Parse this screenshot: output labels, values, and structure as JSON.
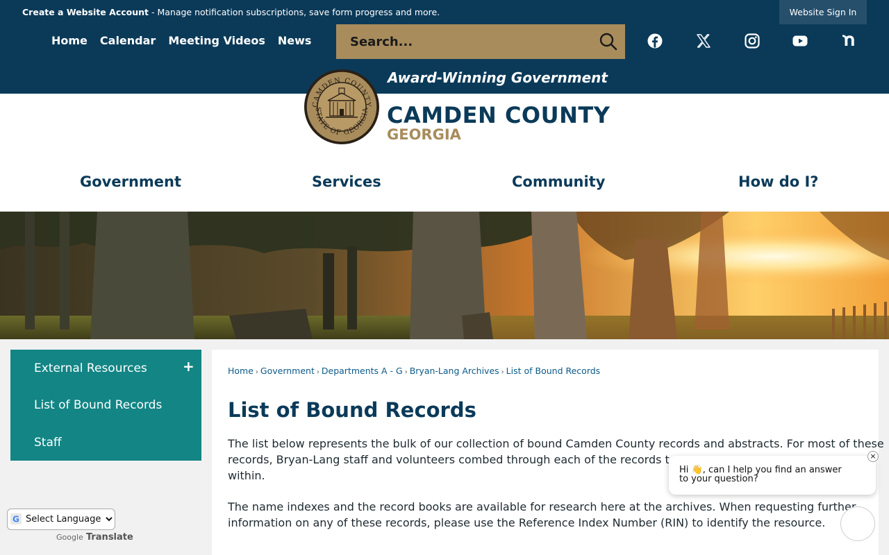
{
  "topbar": {
    "account_link": "Create a Website Account",
    "account_text": " - Manage notification subscriptions, save form progress and more.",
    "signin": "Website Sign In"
  },
  "topnav": [
    "Home",
    "Calendar",
    "Meeting Videos",
    "News"
  ],
  "search": {
    "placeholder": "Search..."
  },
  "social": [
    "facebook-icon",
    "x-icon",
    "instagram-icon",
    "youtube-icon",
    "nextdoor-icon"
  ],
  "branding": {
    "tagline": "Award-Winning Government",
    "county": "CAMDEN COUNTY",
    "state": "GEORGIA",
    "seal_top": "CAMDEN COUNTY",
    "seal_bottom": "STATE OF GEORGIA"
  },
  "mainnav": [
    "Government",
    "Services",
    "Community",
    "How do I?"
  ],
  "sidebar": {
    "items": [
      "External Resources",
      "List of Bound Records",
      "Staff"
    ],
    "expand_symbol": "+"
  },
  "breadcrumb": [
    "Home",
    "Government",
    "Departments A - G",
    "Bryan-Lang Archives",
    "List of Bound Records"
  ],
  "page": {
    "title": "List of Bound Records",
    "para1_lines": [
      "The list below represents the bulk of our collection of bound Camden County records and abstracts. For most of these",
      "records, Bryan-Lang staff and volunteers combed through each of the records to cre",
      "within."
    ],
    "para2_lines": [
      "The name indexes and the record books are available for research here at the archives. When requesting further",
      "information on any of these records, please use the Reference Index Number (RIN) to identify the resource."
    ]
  },
  "translate": {
    "select_value": "Select Language",
    "powered": "Google",
    "label": "Translate"
  },
  "chat": {
    "message": "Hi 👋, can I help you find an answer to your question?",
    "close": "×"
  },
  "colors": {
    "navy": "#0b3a59",
    "gold": "#a88c5c",
    "teal": "#138585"
  }
}
